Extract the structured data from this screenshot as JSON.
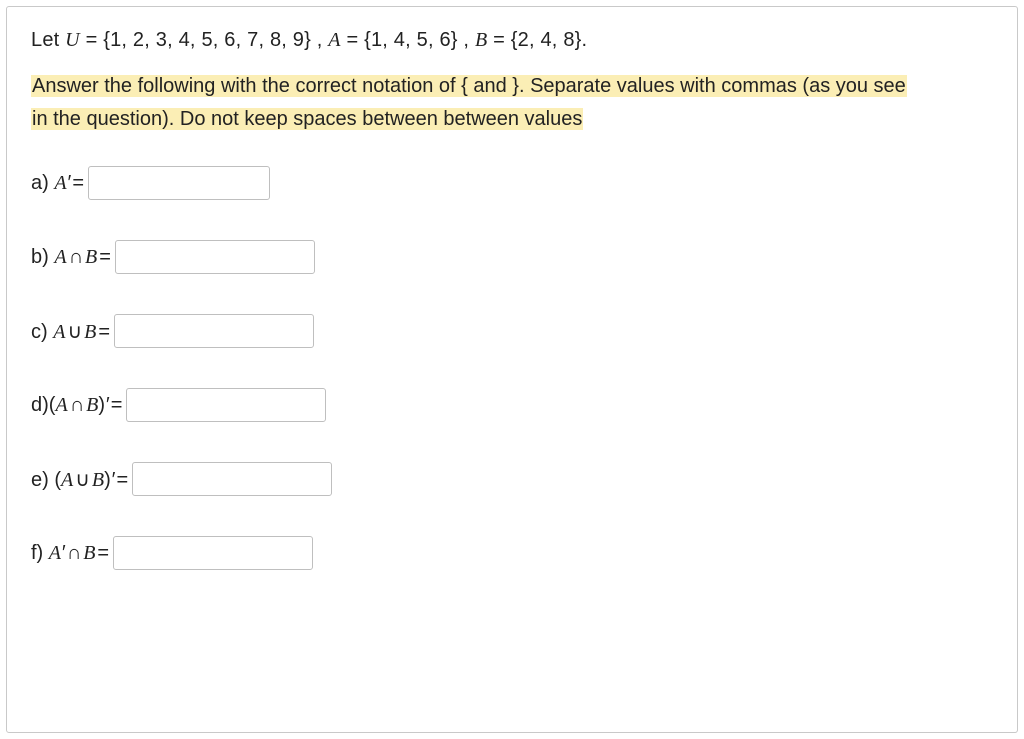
{
  "intro": {
    "prefix": "Let ",
    "U_var": "U",
    "U_set": " = {1, 2, 3, 4, 5, 6, 7, 8, 9} ,  ",
    "A_var": "A",
    "A_set": " = {1, 4, 5, 6} ,  ",
    "B_var": "B",
    "B_set": " = {2, 4, 8}."
  },
  "instructions": {
    "line1": "Answer the following with the correct notation of { and }. Separate values with commas (as you see",
    "line2": "in the question). Do not keep spaces between between values"
  },
  "questions": {
    "a": {
      "letter": "a)",
      "expr_plain": "A' ="
    },
    "b": {
      "letter": "b)",
      "expr_plain": "A ∩ B ="
    },
    "c": {
      "letter": "c)",
      "expr_plain": "A ∪ B ="
    },
    "d": {
      "letter": "d)",
      "expr_plain": "(A ∩ B)' ="
    },
    "e": {
      "letter": "e)",
      "expr_plain": "(A ∪ B)' ="
    },
    "f": {
      "letter": "f)",
      "expr_plain": "A' ∩ B ="
    }
  },
  "answers": {
    "a": "",
    "b": "",
    "c": "",
    "d": "",
    "e": "",
    "f": ""
  }
}
